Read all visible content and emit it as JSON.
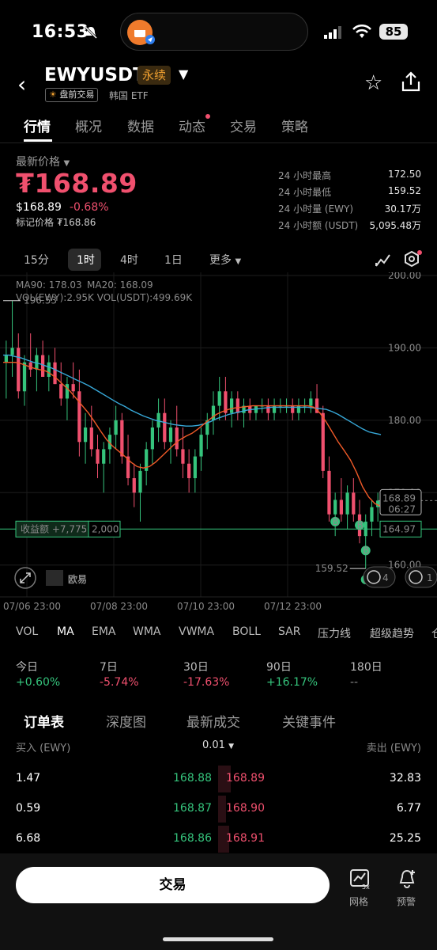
{
  "status_bar": {
    "time": "16:53",
    "battery": "85"
  },
  "header": {
    "symbol": "EWYUSDT",
    "perp_badge": "永续",
    "premarket_label": "盘前交易",
    "category": "韩国 ETF"
  },
  "tabs": [
    {
      "label": "行情",
      "active": true
    },
    {
      "label": "概况"
    },
    {
      "label": "数据"
    },
    {
      "label": "动态",
      "dot": true
    },
    {
      "label": "交易"
    },
    {
      "label": "策略"
    }
  ],
  "price": {
    "label": "最新价格",
    "big": "₮168.89",
    "usd": "$168.89",
    "change": "-0.68%",
    "mark": "标记价格 ₮168.86"
  },
  "stats": [
    {
      "label": "24 小时最高",
      "value": "172.50"
    },
    {
      "label": "24 小时最低",
      "value": "159.52"
    },
    {
      "label": "24 小时量 (EWY)",
      "value": "30.17万"
    },
    {
      "label": "24 小时额 (USDT)",
      "value": "5,095.48万"
    }
  ],
  "timeframes": [
    "15分",
    "1时",
    "4时",
    "1日",
    "更多"
  ],
  "active_timeframe": "1时",
  "chart_legend": {
    "ma90": "MA90: 178.03",
    "ma20": "MA20: 168.09",
    "vol": "VOL(EWY):2.95K VOL(USDT):499.69K"
  },
  "chart_data": {
    "type": "candlestick",
    "y_ticks": [
      "200.00",
      "190.00",
      "180.00",
      "170.00",
      "160.00"
    ],
    "ylim": [
      158,
      200
    ],
    "x_ticks": [
      "07/06 23:00",
      "07/08 23:00",
      "07/10 23:00",
      "07/12 23:00"
    ],
    "high_marker": "196.53",
    "low_marker": "159.52",
    "current_price": "168.89",
    "countdown": "06:27",
    "position_price": "164.97",
    "pnl_label": "收益额 +7,775",
    "position_size": "2,000",
    "watermark": "欧易",
    "buy_marker": "B",
    "side_counts": [
      "4",
      "1"
    ],
    "colors": {
      "ma90": "#37a8d8",
      "ma20": "#f05a28",
      "up": "#35c47c",
      "down": "#f0506e"
    },
    "candles": [
      [
        188,
        191,
        183,
        189
      ],
      [
        189,
        196.5,
        186,
        190
      ],
      [
        190,
        192,
        183,
        184
      ],
      [
        184,
        189,
        182,
        188
      ],
      [
        188,
        192,
        186,
        187
      ],
      [
        187,
        190,
        184,
        189
      ],
      [
        189,
        191,
        186,
        186
      ],
      [
        186,
        189,
        184,
        188
      ],
      [
        188,
        190,
        185,
        185
      ],
      [
        185,
        188,
        182,
        183
      ],
      [
        183,
        186,
        180,
        185
      ],
      [
        185,
        188,
        183,
        184
      ],
      [
        184,
        187,
        175,
        177
      ],
      [
        177,
        181,
        174,
        179
      ],
      [
        179,
        182,
        175,
        176
      ],
      [
        176,
        178,
        172,
        174
      ],
      [
        174,
        177,
        170,
        176
      ],
      [
        176,
        179,
        174,
        178
      ],
      [
        178,
        182,
        176,
        180
      ],
      [
        180,
        181,
        174,
        175
      ],
      [
        175,
        178,
        171,
        172
      ],
      [
        172,
        174,
        168,
        170
      ],
      [
        170,
        174,
        166,
        173
      ],
      [
        173,
        177,
        171,
        176
      ],
      [
        176,
        180,
        174,
        179
      ],
      [
        179,
        183,
        177,
        181
      ],
      [
        181,
        183,
        176,
        177
      ],
      [
        177,
        180,
        174,
        179
      ],
      [
        179,
        182,
        175,
        176
      ],
      [
        176,
        179,
        172,
        174
      ],
      [
        174,
        176,
        170,
        172
      ],
      [
        172,
        176,
        170,
        175
      ],
      [
        175,
        179,
        173,
        178
      ],
      [
        178,
        181,
        176,
        180
      ],
      [
        180,
        184,
        178,
        182
      ],
      [
        182,
        186,
        180,
        184
      ],
      [
        184,
        186,
        180,
        181
      ],
      [
        181,
        184,
        179,
        183
      ],
      [
        183,
        184,
        180,
        181
      ],
      [
        181,
        183,
        179,
        182
      ],
      [
        182,
        183,
        180,
        181
      ],
      [
        181,
        182,
        180,
        182
      ],
      [
        182,
        183,
        181,
        182
      ],
      [
        182,
        183,
        180,
        181
      ],
      [
        181,
        183,
        180,
        182
      ],
      [
        182,
        183,
        181,
        182
      ],
      [
        182,
        183,
        181,
        182
      ],
      [
        182,
        183,
        180,
        181
      ],
      [
        181,
        183,
        180,
        182
      ],
      [
        182,
        183,
        181,
        182
      ],
      [
        182,
        184,
        181,
        183
      ],
      [
        183,
        185,
        181,
        181
      ],
      [
        181,
        182,
        172,
        173
      ],
      [
        173,
        175,
        166,
        167
      ],
      [
        167,
        170,
        164,
        169
      ],
      [
        169,
        172,
        166,
        167
      ],
      [
        167,
        171,
        165,
        170
      ],
      [
        170,
        172,
        166,
        167
      ],
      [
        167,
        169,
        163,
        164
      ],
      [
        164,
        167,
        159.5,
        166
      ],
      [
        166,
        169,
        164,
        168
      ],
      [
        168,
        170,
        166,
        168.9
      ]
    ],
    "ma20": [
      188,
      188,
      188,
      187.8,
      187.5,
      187.2,
      187,
      186.8,
      186.3,
      185.6,
      184.8,
      184,
      183,
      182,
      181,
      179.8,
      178.5,
      177.3,
      176.4,
      175.7,
      175,
      174.2,
      173.6,
      173.4,
      173.6,
      174.2,
      175,
      175.8,
      176.6,
      177.3,
      177.8,
      178.2,
      178.8,
      179.5,
      180.2,
      180.8,
      181.2,
      181.5,
      181.7,
      181.8,
      181.9,
      182,
      182,
      182,
      182,
      182,
      182,
      182,
      182,
      182,
      182,
      181.8,
      181,
      179.8,
      178.4,
      177,
      175.8,
      174.5,
      172.8,
      170.8,
      169.4,
      168.5,
      168.1
    ],
    "ma90": [
      189,
      189,
      188.8,
      188.6,
      188.3,
      188,
      187.8,
      187.5,
      187.2,
      186.8,
      186.4,
      186,
      185.6,
      185.2,
      184.8,
      184.3,
      183.8,
      183.3,
      182.8,
      182.3,
      181.9,
      181.4,
      181,
      180.6,
      180.3,
      180,
      179.8,
      179.6,
      179.4,
      179.3,
      179.2,
      179.2,
      179.3,
      179.5,
      179.8,
      180.2,
      180.5,
      180.8,
      181,
      181.2,
      181.4,
      181.5,
      181.6,
      181.7,
      181.8,
      181.8,
      181.8,
      181.8,
      181.8,
      181.8,
      181.8,
      181.7,
      181.6,
      181.5,
      181.2,
      180.8,
      180.3,
      179.8,
      179.3,
      178.8,
      178.4,
      178.2,
      178.03
    ]
  },
  "indicators": [
    "VOL",
    "MA",
    "EMA",
    "WMA",
    "VWMA",
    "BOLL",
    "SAR",
    "压力线",
    "超级趋势",
    "仓"
  ],
  "active_indicators": [
    "MA"
  ],
  "performance": [
    {
      "label": "今日",
      "value": "+0.60%",
      "tone": "up"
    },
    {
      "label": "7日",
      "value": "-5.74%",
      "tone": "down"
    },
    {
      "label": "30日",
      "value": "-17.63%",
      "tone": "down"
    },
    {
      "label": "90日",
      "value": "+16.17%",
      "tone": "up"
    },
    {
      "label": "180日",
      "value": "--",
      "tone": "neutral"
    }
  ],
  "orderbook_tabs": [
    {
      "label": "订单表",
      "active": true
    },
    {
      "label": "深度图"
    },
    {
      "label": "最新成交"
    },
    {
      "label": "关键事件"
    }
  ],
  "orderbook": {
    "buy_header": "买入 (EWY)",
    "precision": "0.01",
    "sell_header": "卖出 (EWY)",
    "rows": [
      {
        "bid_qty": "1.47",
        "bid": "168.88",
        "ask": "168.89",
        "ask_qty": "32.83"
      },
      {
        "bid_qty": "0.59",
        "bid": "168.87",
        "ask": "168.90",
        "ask_qty": "6.77"
      },
      {
        "bid_qty": "6.68",
        "bid": "168.86",
        "ask": "168.91",
        "ask_qty": "25.25"
      }
    ]
  },
  "bottom": {
    "trade_label": "交易",
    "grid_label": "网格",
    "alert_label": "预警",
    "grid_badge": "5x"
  }
}
